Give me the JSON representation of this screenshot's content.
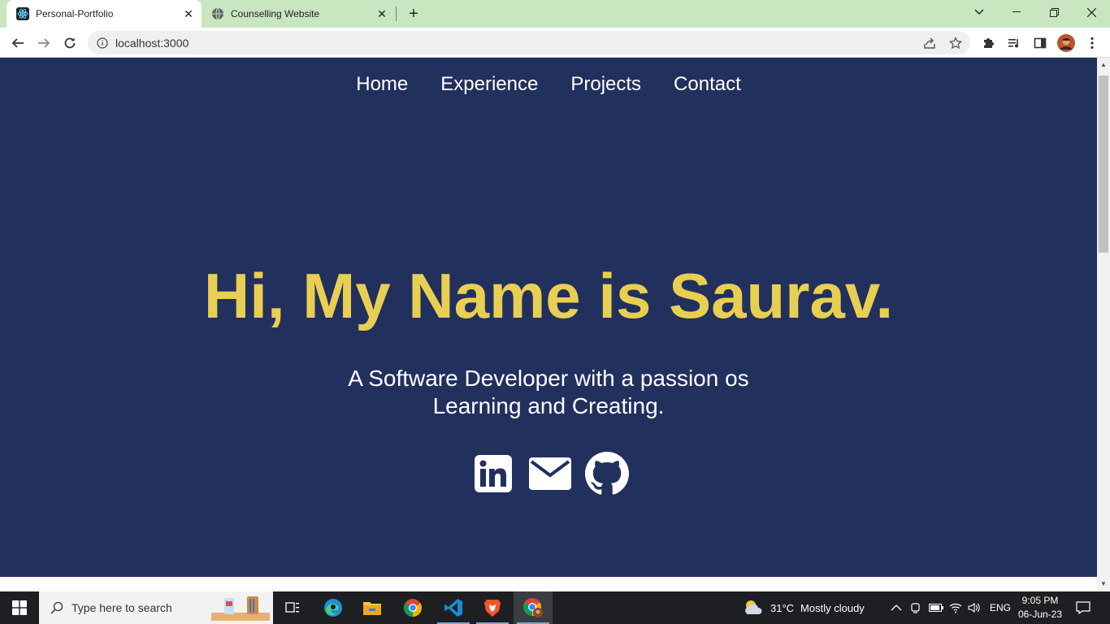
{
  "browser": {
    "tabs": [
      {
        "title": "Personal-Portfolio",
        "active": true
      },
      {
        "title": "Counselling Website",
        "active": false
      }
    ],
    "url": "localhost:3000"
  },
  "nav": {
    "items": [
      "Home",
      "Experience",
      "Projects",
      "Contact"
    ]
  },
  "hero": {
    "title": "Hi, My Name is Saurav.",
    "subtitle_line1": "A Software Developer with a passion os",
    "subtitle_line2": "Learning and Creating."
  },
  "socials": [
    "linkedin-icon",
    "mail-icon",
    "github-icon"
  ],
  "colors": {
    "page_bg": "#22305e",
    "accent": "#e8cf52",
    "tabstrip_bg": "#c8e6c0"
  },
  "taskbar": {
    "search_placeholder": "Type here to search",
    "weather_temp": "31°C",
    "weather_text": "Mostly cloudy",
    "language": "ENG",
    "time": "9:05 PM",
    "date": "06-Jun-23"
  }
}
